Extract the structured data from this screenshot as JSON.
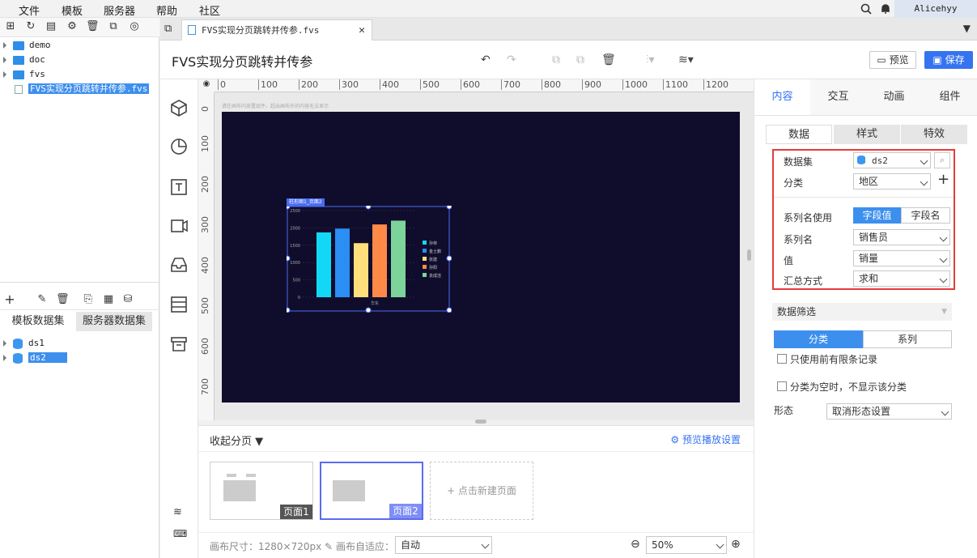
{
  "menu": {
    "items": [
      "文件",
      "模板",
      "服务器",
      "帮助",
      "社区"
    ],
    "user": "Alicehyy"
  },
  "tree": {
    "items": [
      {
        "label": "demo",
        "type": "folder"
      },
      {
        "label": "doc",
        "type": "folder"
      },
      {
        "label": "fvs",
        "type": "folder"
      },
      {
        "label": "FVS实现分页跳转并传参.fvs",
        "type": "file",
        "selected": true
      }
    ]
  },
  "datasets": {
    "tabs": [
      "模板数据集",
      "服务器数据集"
    ],
    "items": [
      {
        "label": "ds1"
      },
      {
        "label": "ds2",
        "selected": true
      }
    ]
  },
  "doc_tab": {
    "label": "FVS实现分页跳转并传参.fvs"
  },
  "header": {
    "title": "FVS实现分页跳转并传参",
    "preview": "预览",
    "save": "保存"
  },
  "canvas": {
    "hint": "请在画布内放置组件，超出画布外的内容无法显示",
    "ruler_top": [
      "0",
      "100",
      "200",
      "300",
      "400",
      "500",
      "600",
      "700",
      "800",
      "900",
      "1000",
      "1100",
      "1200"
    ],
    "ruler_left": [
      "0",
      "100",
      "200",
      "300",
      "400",
      "500",
      "600",
      "700"
    ],
    "widget_label": "柱形图1_页面2"
  },
  "chart_data": {
    "type": "bar",
    "categories": [
      "华东"
    ],
    "series": [
      {
        "name": "孙林",
        "values": [
          1870
        ],
        "color": "#12d8f5"
      },
      {
        "name": "金士鹏",
        "values": [
          1980
        ],
        "color": "#2a8ef5"
      },
      {
        "name": "张建",
        "values": [
          1560
        ],
        "color": "#ffe07a"
      },
      {
        "name": "孙阳",
        "values": [
          2100
        ],
        "color": "#ff8a48"
      },
      {
        "name": "袁成洁",
        "values": [
          2210
        ],
        "color": "#7cd49a"
      }
    ],
    "ylim": [
      0,
      2500
    ],
    "yticks": [
      "0",
      "500",
      "1000",
      "1500",
      "2000",
      "2500"
    ],
    "legend": "right",
    "grid": true
  },
  "pages": {
    "collapse": "收起分页",
    "settings": "预览播放设置",
    "items": [
      "页面1",
      "页面2"
    ],
    "new_page": "+ 点击新建页面",
    "size_label": "画布尺寸：1280×720px",
    "adapt_label": "画布自适应：",
    "adapt_value": "自动",
    "zoom": "50%"
  },
  "right_panel": {
    "tabs": [
      "内容",
      "交互",
      "动画",
      "组件"
    ],
    "subtabs": [
      "数据",
      "样式",
      "特效"
    ],
    "fields": {
      "dataset_label": "数据集",
      "dataset_value": "ds2",
      "category_label": "分类",
      "category_value": "地区",
      "series_name_use_label": "系列名使用",
      "opt_field_value": "字段值",
      "opt_field_name": "字段名",
      "series_name_label": "系列名",
      "series_name_value": "销售员",
      "value_label": "值",
      "value_value": "销量",
      "agg_label": "汇总方式",
      "agg_value": "求和"
    },
    "filter": {
      "label": "数据筛选",
      "seg_category": "分类",
      "seg_series": "系列",
      "check1": "只使用前有限条记录",
      "check2": "分类为空时，不显示该分类",
      "shape_label": "形态",
      "shape_value": "取消形态设置"
    }
  }
}
